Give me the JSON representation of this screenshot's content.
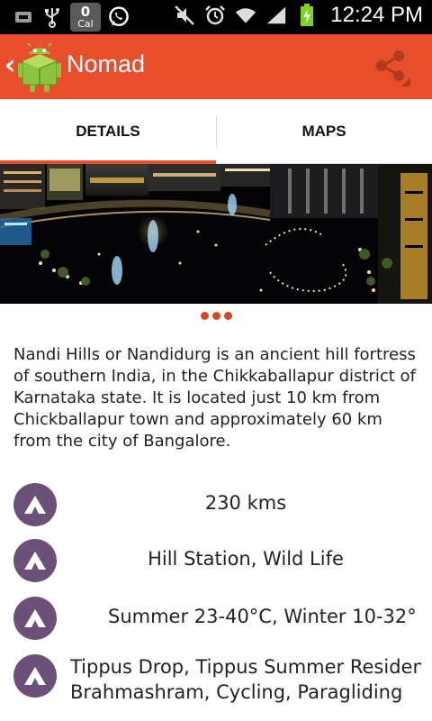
{
  "status_bar": {
    "notification_count": "0",
    "notification_label": "Cal",
    "time": "12:24 PM",
    "icons": [
      "screenshot-icon",
      "usb-icon",
      "calendar-badge",
      "whatsapp-icon",
      "mute-icon",
      "alarm-icon",
      "wifi-icon",
      "signal-icon",
      "battery-charging-icon"
    ]
  },
  "action_bar": {
    "title": "Nomad",
    "back_icon": "chevron-left-icon",
    "app_icon": "android-icon",
    "share_icon": "share-icon",
    "color": "#e84e2c"
  },
  "tabs": [
    {
      "label": "DETAILS",
      "selected": true
    },
    {
      "label": "MAPS",
      "selected": false
    }
  ],
  "gallery": {
    "page_count": 3
  },
  "description": "Nandi Hills or Nandidurg is an ancient hill fortress of southern India, in the Chikkaballapur district of Karnataka state. It is located just 10 km from Chickballapur town and approximately 60 km from the city of Bangalore.",
  "info": {
    "distance": "230 kms",
    "category": "Hill Station, Wild Life",
    "weather": "Summer 23-40°C, Winter 10-32°",
    "attractions_line1": "Tippus Drop, Tippus Summer Residence,",
    "attractions_line2": "Brahmashram, Cycling, Paragliding",
    "icon": "mountain-icon",
    "icon_color": "#6b5178"
  }
}
